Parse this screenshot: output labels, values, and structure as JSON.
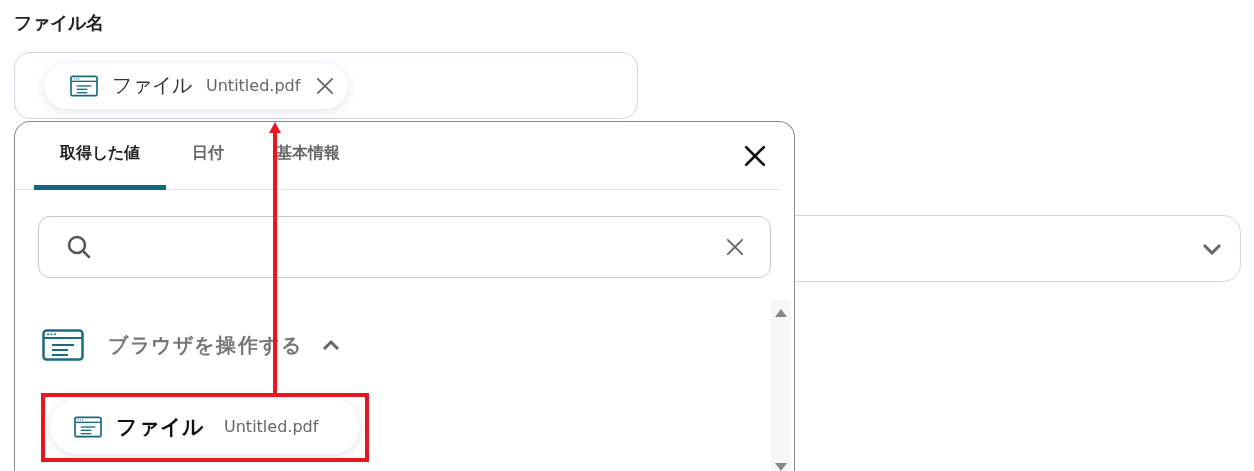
{
  "field_label": "ファイル名",
  "file_name_field": {
    "tokens": [
      {
        "label": "ファイル",
        "value": "Untitled.pdf"
      }
    ]
  },
  "picker": {
    "tabs": [
      {
        "label": "取得した値",
        "selected": true
      },
      {
        "label": "日付",
        "selected": false
      },
      {
        "label": "基本情報",
        "selected": false
      }
    ],
    "groups": [
      {
        "title": "ブラウザを操作する",
        "expanded": true,
        "items": [
          {
            "label": "ファイル",
            "value": "Untitled.pdf"
          }
        ]
      }
    ]
  }
}
